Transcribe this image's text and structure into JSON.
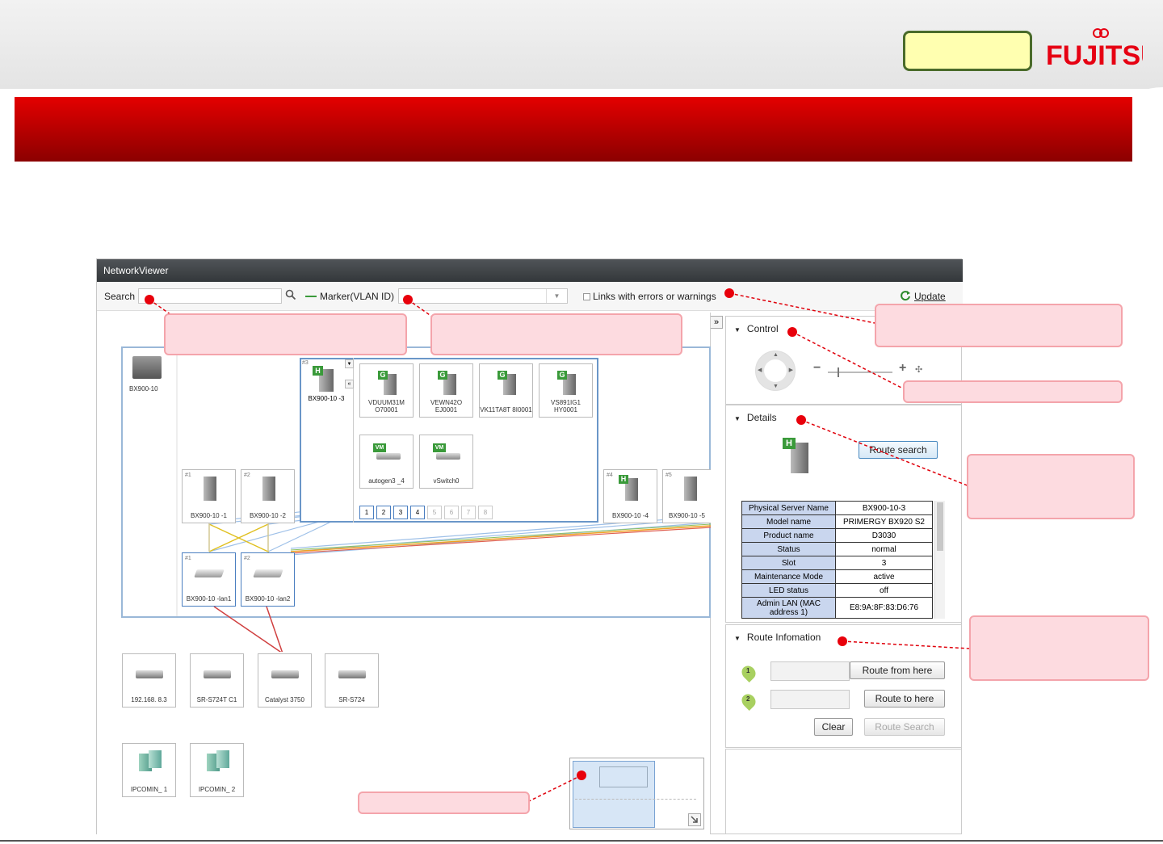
{
  "brand": {
    "logo_text": "FUJITSU"
  },
  "app": {
    "title": "NetworkViewer",
    "toolbar": {
      "search_label": "Search",
      "search_value": "",
      "marker_label": "Marker(VLAN ID)",
      "marker_value": "",
      "links_label": "Links with errors or warnings",
      "update_label": "Update"
    },
    "collapse_glyph": "»"
  },
  "topology": {
    "chassis_label": "BX900-10",
    "blade3": {
      "index": "#3",
      "label": "BX900-10 -3"
    },
    "guests": [
      {
        "label": "VDUUM31M O70001"
      },
      {
        "label": "VEWN42O EJ0001"
      },
      {
        "label": "VK11TA8T 8I0001"
      },
      {
        "label": "VS891IG1 HY0001"
      }
    ],
    "vswitches": [
      {
        "label": "autogen3 _4"
      },
      {
        "label": "vSwitch0"
      }
    ],
    "pages": [
      "1",
      "2",
      "3",
      "4",
      "5",
      "6",
      "7",
      "8"
    ],
    "blades": [
      {
        "index": "#1",
        "label": "BX900-10 -1"
      },
      {
        "index": "#2",
        "label": "BX900-10 -2"
      },
      {
        "index": "#4",
        "label": "BX900-10 -4"
      },
      {
        "index": "#5",
        "label": "BX900-10 -5"
      }
    ],
    "lans": [
      {
        "index": "#1",
        "label": "BX900-10 -lan1"
      },
      {
        "index": "#2",
        "label": "BX900-10 -lan2"
      }
    ],
    "switches": [
      {
        "label": "192.168. 8.3"
      },
      {
        "label": "SR-S724T C1"
      },
      {
        "label": "Catalyst 3750"
      },
      {
        "label": "SR-S724"
      }
    ],
    "ipcom": [
      {
        "label": "IPCOMIN_ 1"
      },
      {
        "label": "IPCOMIN_ 2"
      }
    ]
  },
  "control": {
    "title": "Control"
  },
  "details": {
    "title": "Details",
    "route_search_button": "Route search",
    "rows": [
      {
        "key": "Physical Server Name",
        "value": "BX900-10-3"
      },
      {
        "key": "Model name",
        "value": "PRIMERGY BX920 S2"
      },
      {
        "key": "Product name",
        "value": "D3030"
      },
      {
        "key": "Status",
        "value": "normal"
      },
      {
        "key": "Slot",
        "value": "3"
      },
      {
        "key": "Maintenance Mode",
        "value": "active"
      },
      {
        "key": "LED status",
        "value": "off"
      },
      {
        "key": "Admin LAN (MAC address 1)",
        "value": "E8:9A:8F:83:D6:76"
      }
    ]
  },
  "route": {
    "title": "Route Infomation",
    "route_from_button": "Route from here",
    "route_to_button": "Route to here",
    "clear_button": "Clear",
    "route_search_button": "Route Search",
    "badge1": "1",
    "badge2": "2"
  },
  "colors": {
    "brand_red": "#e60012",
    "banner_red": "#cc0000",
    "callout": "#fddbe0"
  }
}
